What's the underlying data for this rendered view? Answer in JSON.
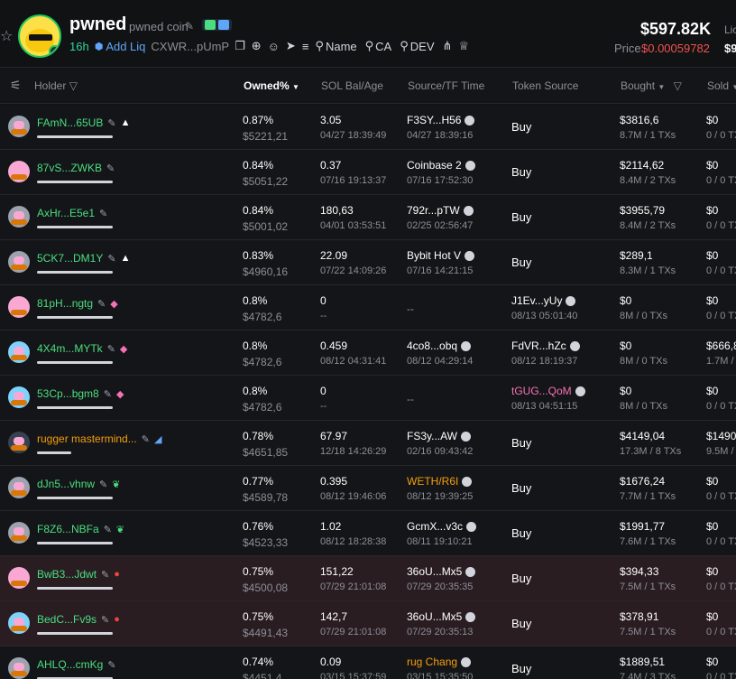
{
  "token": {
    "name": "pwned",
    "subtitle": "pwned coin",
    "age": "16h",
    "add_liq": "Add Liq",
    "ca_short": "CXWR...pUmP",
    "links": [
      {
        "label": "Name",
        "icon": "search-icon"
      },
      {
        "label": "CA",
        "icon": "search-icon"
      },
      {
        "label": "DEV",
        "icon": "search-icon"
      }
    ],
    "market_cap": "$597.82K",
    "price_label": "Price",
    "price": "$0.00059782",
    "liq_label": "Lic",
    "liq_value": "$9"
  },
  "table": {
    "columns": {
      "holder": "Holder",
      "owned": "Owned%",
      "sol": "SOL Bal/Age",
      "source": "Source/TF Time",
      "token_source": "Token Source",
      "bought": "Bought",
      "sold": "Sold"
    },
    "rows": [
      {
        "holder": "FAmN...65UB",
        "tag": "▲",
        "tag_color": "#ffffff",
        "avatar": "gray",
        "bar": 84,
        "flag": false,
        "owned": "0.87%",
        "owned_usd": "$5221,21",
        "sol": "3.05",
        "sol_age": "04/27 18:39:49",
        "src": "F3SY...H56",
        "src_color": "white",
        "src_time": "04/27 18:39:16",
        "ts_type": "buy",
        "ts": "Buy",
        "ts_time": "",
        "bought": "$3816,6",
        "bought_sub": "8.7M / 1 TXs",
        "sold": "$0",
        "sold_sub": "0 / 0 TX"
      },
      {
        "holder": "87vS...ZWKB",
        "tag": "",
        "tag_color": "#ffffff",
        "avatar": "pink",
        "bar": 84,
        "flag": false,
        "owned": "0.84%",
        "owned_usd": "$5051,22",
        "sol": "0.37",
        "sol_age": "07/16 19:13:37",
        "src": "Coinbase 2",
        "src_color": "white",
        "src_time": "07/16 17:52:30",
        "ts_type": "buy",
        "ts": "Buy",
        "ts_time": "",
        "bought": "$2114,62",
        "bought_sub": "8.4M / 2 TXs",
        "sold": "$0",
        "sold_sub": "0 / 0 TX"
      },
      {
        "holder": "AxHr...E5e1",
        "tag": "",
        "tag_color": "#ffffff",
        "avatar": "gray",
        "bar": 84,
        "flag": false,
        "owned": "0.84%",
        "owned_usd": "$5001,02",
        "sol": "180,63",
        "sol_age": "04/01 03:53:51",
        "src": "792r...pTW",
        "src_color": "white",
        "src_time": "02/25 02:56:47",
        "ts_type": "buy",
        "ts": "Buy",
        "ts_time": "",
        "bought": "$3955,79",
        "bought_sub": "8.4M / 2 TXs",
        "sold": "$0",
        "sold_sub": "0 / 0 TX"
      },
      {
        "holder": "5CK7...DM1Y",
        "tag": "▲",
        "tag_color": "#ffffff",
        "avatar": "gray",
        "bar": 84,
        "flag": false,
        "owned": "0.83%",
        "owned_usd": "$4960,16",
        "sol": "22.09",
        "sol_age": "07/22 14:09:26",
        "src": "Bybit Hot V",
        "src_color": "white",
        "src_time": "07/16 14:21:15",
        "ts_type": "buy",
        "ts": "Buy",
        "ts_time": "",
        "bought": "$289,1",
        "bought_sub": "8.3M / 1 TXs",
        "sold": "$0",
        "sold_sub": "0 / 0 TX"
      },
      {
        "holder": "81pH...ngtg",
        "tag": "◆",
        "tag_color": "#f472b6",
        "avatar": "pink",
        "bar": 84,
        "flag": false,
        "owned": "0.8%",
        "owned_usd": "$4782,6",
        "sol": "0",
        "sol_age": "--",
        "src": "",
        "src_color": "white",
        "src_time": "--",
        "ts_type": "addr",
        "ts": "J1Ev...yUy",
        "ts_color": "white",
        "ts_time": "08/13 05:01:40",
        "bought": "$0",
        "bought_sub": "8M / 0 TXs",
        "sold": "$0",
        "sold_sub": "0 / 0 TX"
      },
      {
        "holder": "4X4m...MYTk",
        "tag": "◆",
        "tag_color": "#f472b6",
        "avatar": "blue",
        "bar": 84,
        "flag": false,
        "owned": "0.8%",
        "owned_usd": "$4782,6",
        "sol": "0.459",
        "sol_age": "08/12 04:31:41",
        "src": "4co8...obq",
        "src_color": "white",
        "src_time": "08/12 04:29:14",
        "ts_type": "addr",
        "ts": "FdVR...hZc",
        "ts_color": "white",
        "ts_time": "08/12 18:19:37",
        "bought": "$0",
        "bought_sub": "8M / 0 TXs",
        "sold": "$666,8",
        "sold_sub": "1.7M /"
      },
      {
        "holder": "53Cp...bgm8",
        "tag": "◆",
        "tag_color": "#f472b6",
        "avatar": "blue",
        "bar": 84,
        "flag": false,
        "owned": "0.8%",
        "owned_usd": "$4782,6",
        "sol": "0",
        "sol_age": "--",
        "src": "",
        "src_color": "white",
        "src_time": "--",
        "ts_type": "addr",
        "ts": "tGUG...QoM",
        "ts_color": "pink",
        "ts_time": "08/13 04:51:15",
        "bought": "$0",
        "bought_sub": "8M / 0 TXs",
        "sold": "$0",
        "sold_sub": "0 / 0 TX"
      },
      {
        "holder": "rugger mastermind...",
        "tag": "◢",
        "tag_color": "#60a5fa",
        "avatar": "dark",
        "bar": 38,
        "flag": false,
        "owned": "0.78%",
        "owned_usd": "$4651,85",
        "sol": "67.97",
        "sol_age": "12/18 14:26:29",
        "src": "FS3y...AW",
        "src_color": "white",
        "src_time": "02/16 09:43:42",
        "ts_type": "buy",
        "ts": "Buy",
        "ts_time": "",
        "bought": "$4149,04",
        "bought_sub": "17.3M / 8 TXs",
        "sold": "$1490",
        "sold_sub": "9.5M /"
      },
      {
        "holder": "dJn5...vhnw",
        "tag": "❦",
        "tag_color": "#4ade80",
        "avatar": "gray",
        "bar": 84,
        "flag": false,
        "owned": "0.77%",
        "owned_usd": "$4589,78",
        "sol": "0.395",
        "sol_age": "08/12 19:46:06",
        "src": "WETH/R6I",
        "src_color": "orange",
        "src_time": "08/12 19:39:25",
        "ts_type": "buy",
        "ts": "Buy",
        "ts_time": "",
        "bought": "$1676,24",
        "bought_sub": "7.7M / 1 TXs",
        "sold": "$0",
        "sold_sub": "0 / 0 TX"
      },
      {
        "holder": "F8Z6...NBFa",
        "tag": "❦",
        "tag_color": "#4ade80",
        "avatar": "gray",
        "bar": 84,
        "flag": false,
        "owned": "0.76%",
        "owned_usd": "$4523,33",
        "sol": "1.02",
        "sol_age": "08/12 18:28:38",
        "src": "GcmX...v3c",
        "src_color": "white",
        "src_time": "08/11 19:10:21",
        "ts_type": "buy",
        "ts": "Buy",
        "ts_time": "",
        "bought": "$1991,77",
        "bought_sub": "7.6M / 1 TXs",
        "sold": "$0",
        "sold_sub": "0 / 0 TX"
      },
      {
        "holder": "BwB3...Jdwt",
        "tag": "●",
        "tag_color": "#ef4444",
        "avatar": "pink",
        "bar": 84,
        "flag": true,
        "owned": "0.75%",
        "owned_usd": "$4500,08",
        "sol": "151,22",
        "sol_age": "07/29 21:01:08",
        "src": "36oU...Mx5",
        "src_color": "white",
        "src_time": "07/29 20:35:35",
        "ts_type": "buy",
        "ts": "Buy",
        "ts_time": "",
        "bought": "$394,33",
        "bought_sub": "7.5M / 1 TXs",
        "sold": "$0",
        "sold_sub": "0 / 0 TX"
      },
      {
        "holder": "BedC...Fv9s",
        "tag": "●",
        "tag_color": "#ef4444",
        "avatar": "blue",
        "bar": 84,
        "flag": true,
        "owned": "0.75%",
        "owned_usd": "$4491,43",
        "sol": "142,7",
        "sol_age": "07/29 21:01:08",
        "src": "36oU...Mx5",
        "src_color": "white",
        "src_time": "07/29 20:35:13",
        "ts_type": "buy",
        "ts": "Buy",
        "ts_time": "",
        "bought": "$378,91",
        "bought_sub": "7.5M / 1 TXs",
        "sold": "$0",
        "sold_sub": "0 / 0 TX"
      },
      {
        "holder": "AHLQ...cmKg",
        "tag": "",
        "tag_color": "#ffffff",
        "avatar": "gray",
        "bar": 84,
        "flag": false,
        "owned": "0.74%",
        "owned_usd": "$4451,4",
        "sol": "0.09",
        "sol_age": "03/15 15:37:59",
        "src": "rug Chang",
        "src_color": "orange",
        "src_time": "03/15 15:35:50",
        "ts_type": "buy",
        "ts": "Buy",
        "ts_time": "",
        "bought": "$1889,51",
        "bought_sub": "7.4M / 3 TXs",
        "sold": "$0",
        "sold_sub": "0 / 0 TX"
      }
    ]
  }
}
